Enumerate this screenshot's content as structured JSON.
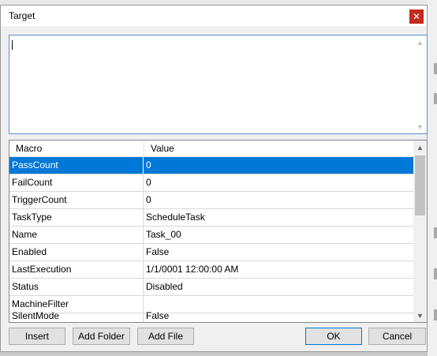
{
  "dialog": {
    "title": "Target",
    "close_symbol": "✕"
  },
  "textarea": {
    "value": ""
  },
  "grid": {
    "columns": [
      "Macro",
      "Value"
    ],
    "rows": [
      {
        "macro": "PassCount",
        "value": "0"
      },
      {
        "macro": "FailCount",
        "value": "0"
      },
      {
        "macro": "TriggerCount",
        "value": "0"
      },
      {
        "macro": "TaskType",
        "value": "ScheduleTask"
      },
      {
        "macro": "Name",
        "value": "Task_00"
      },
      {
        "macro": "Enabled",
        "value": "False"
      },
      {
        "macro": "LastExecution",
        "value": "1/1/0001 12:00:00 AM"
      },
      {
        "macro": "Status",
        "value": "Disabled"
      },
      {
        "macro": "MachineFilter",
        "value": ""
      },
      {
        "macro": "SilentMode",
        "value": "False"
      }
    ],
    "selected_index": 0
  },
  "buttons": {
    "insert": "Insert",
    "add_folder": "Add Folder",
    "add_file": "Add File",
    "ok": "OK",
    "cancel": "Cancel"
  },
  "colors": {
    "selection": "#0078d7",
    "close_button": "#c42b1c",
    "focus_border": "#5a8fd0"
  }
}
